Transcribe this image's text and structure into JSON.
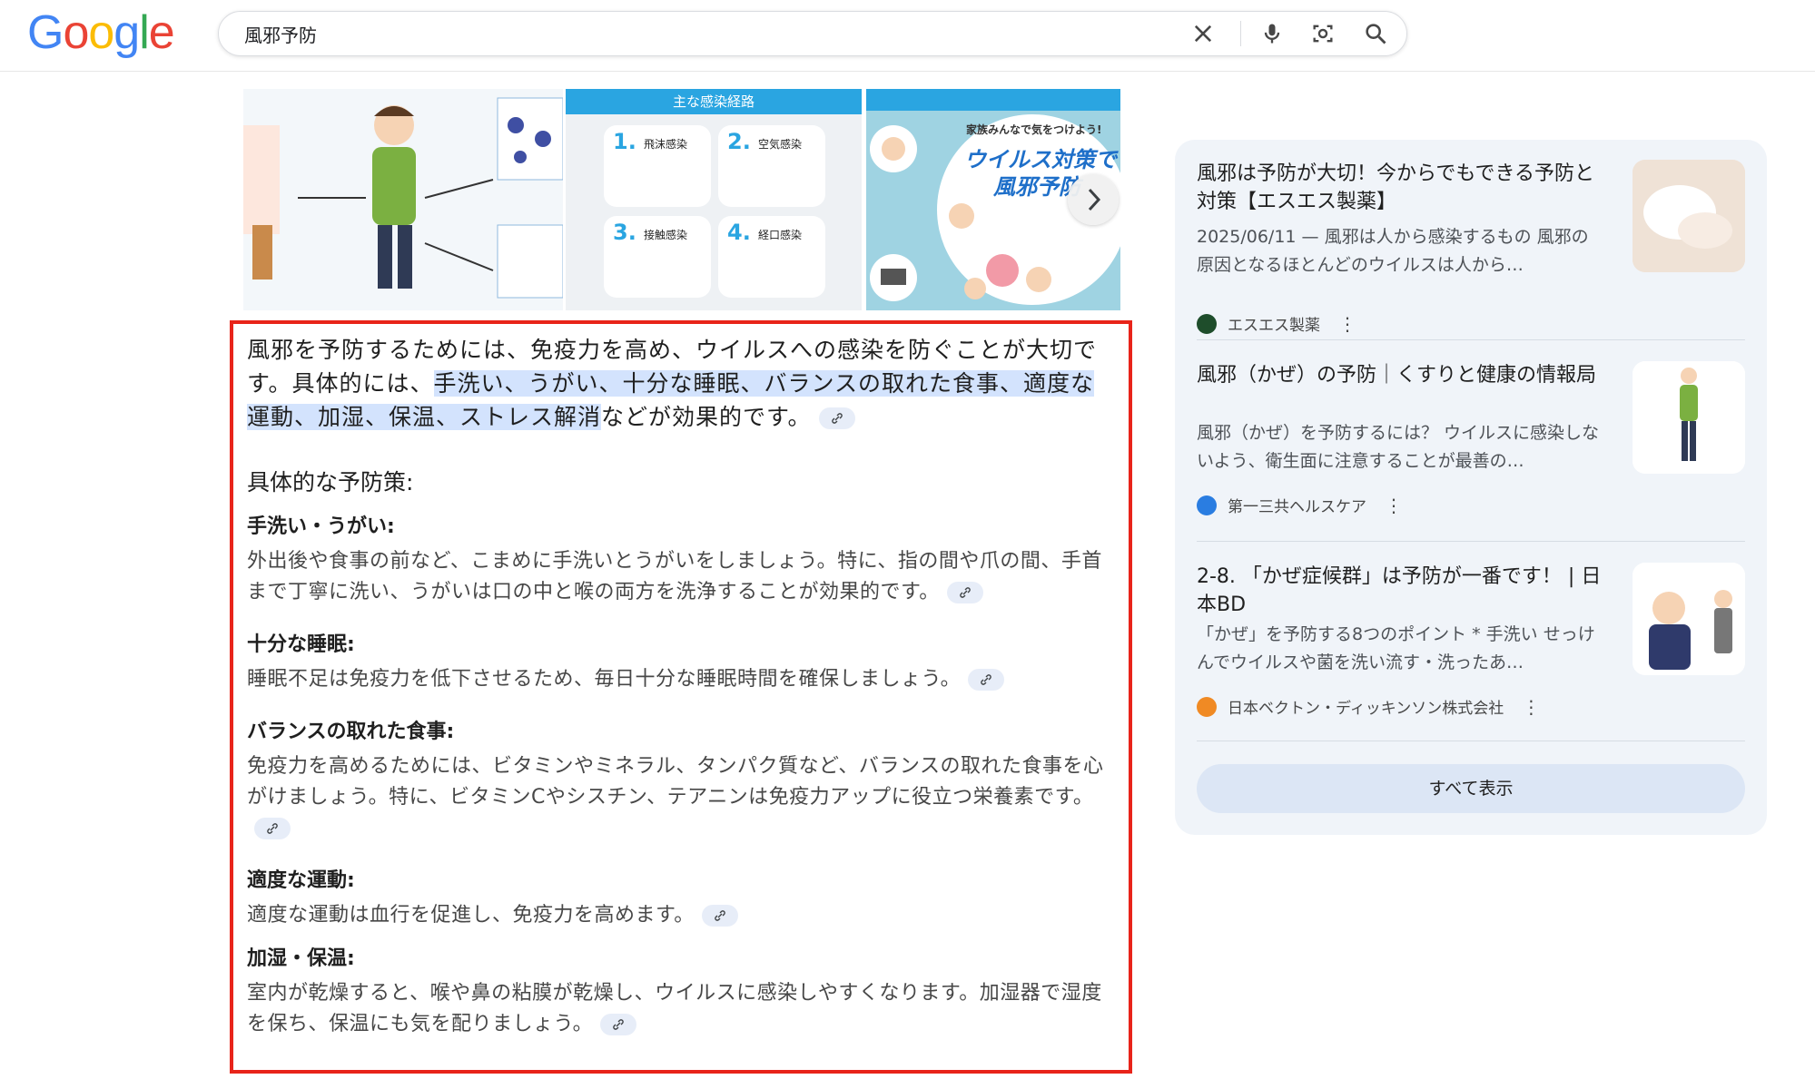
{
  "header": {
    "logo": [
      "G",
      "o",
      "o",
      "g",
      "l",
      "e"
    ],
    "logo_colors": [
      "#4285F4",
      "#EA4335",
      "#FBBC05",
      "#4285F4",
      "#34A853",
      "#EA4335"
    ],
    "query": "風邪予防",
    "icons": [
      "close-icon",
      "mic-icon",
      "camera-lens-icon",
      "search-icon"
    ]
  },
  "images": {
    "img2_header": "主な感染経路",
    "img2_cells": [
      {
        "num": "1.",
        "label": "飛沫感染"
      },
      {
        "num": "2.",
        "label": "空気感染"
      },
      {
        "num": "3.",
        "label": "接触感染"
      },
      {
        "num": "4.",
        "label": "経口感染"
      }
    ],
    "img3_small": "家族みんなで気をつけよう!",
    "img3_title1": "ウイルス対策で",
    "img3_title2": "風邪予防"
  },
  "answer": {
    "lead_pre": "風邪を予防するためには、免疫力を高め、ウイルスへの感染を防ぐことが大切です。具体的には、",
    "lead_highlight": "手洗い、うがい、十分な睡眠、バランスの取れた食事、適度な運動、加湿、保温、ストレス解消",
    "lead_post": "などが効果的です。",
    "section_title": "具体的な予防策:",
    "items": [
      {
        "title": "手洗い・うがい:",
        "text": "外出後や食事の前など、こまめに手洗いとうがいをしましょう。特に、指の間や爪の間、手首まで丁寧に洗い、うがいは口の中と喉の両方を洗浄することが効果的です。"
      },
      {
        "title": "十分な睡眠:",
        "text": "睡眠不足は免疫力を低下させるため、毎日十分な睡眠時間を確保しましょう。"
      },
      {
        "title": "バランスの取れた食事:",
        "text": "免疫力を高めるためには、ビタミンやミネラル、タンパク質など、バランスの取れた食事を心がけましょう。特に、ビタミンCやシスチン、テアニンは免疫力アップに役立つ栄養素です。"
      },
      {
        "title": "適度な運動:",
        "text": "適度な運動は血行を促進し、免疫力を高めます。"
      },
      {
        "title": "加湿・保温:",
        "text": "室内が乾燥すると、喉や鼻の粘膜が乾燥し、ウイルスに感染しやすくなります。加湿器で湿度を保ち、保温にも気を配りましょう。"
      }
    ]
  },
  "sources": [
    {
      "title": "風邪は予防が大切！今からでもできる予防と対策【エスエス製薬】",
      "snippet": "2025/06/11 — 風邪は人から感染するもの 風邪の原因となるほとんどのウイルスは人から…",
      "source": "エスエス製薬",
      "icon_color": "#1e4d2b"
    },
    {
      "title": "風邪（かぜ）の予防｜くすりと健康の情報局",
      "snippet": "風邪（かぜ）を予防するには？ ウイルスに感染しないよう、衛生面に注意することが最善の…",
      "source": "第一三共ヘルスケア",
      "icon_color": "#2a7de1"
    },
    {
      "title": "2-8. 「かぜ症候群」は予防が一番です！ | 日本BD",
      "snippet": "「かぜ」を予防する8つのポイント * 手洗い せっけんでウイルスや菌を洗い流す・洗ったあ…",
      "source": "日本ベクトン・ディッキンソン株式会社",
      "icon_color": "#f08a24"
    }
  ],
  "show_all": "すべて表示"
}
